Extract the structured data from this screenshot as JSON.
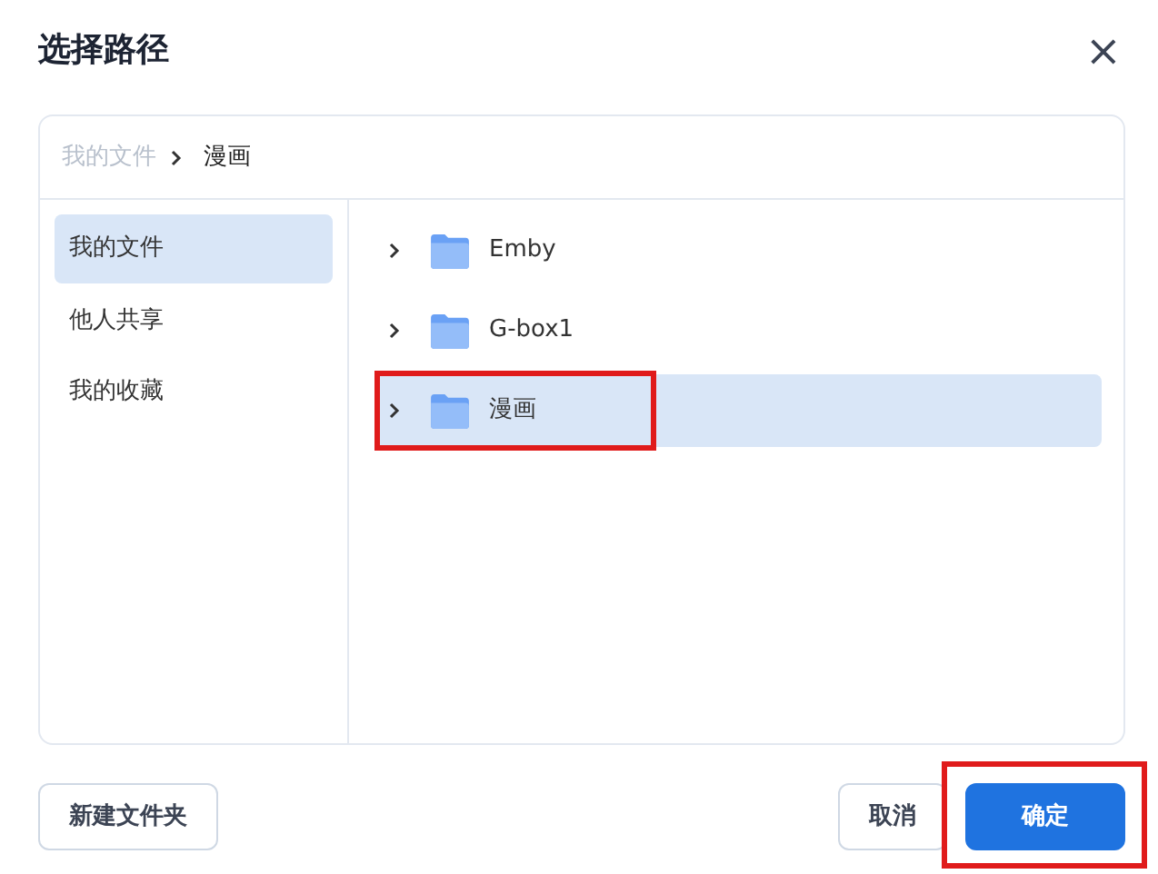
{
  "dialog": {
    "title": "选择路径",
    "close": "×"
  },
  "breadcrumb": [
    {
      "label": "我的文件",
      "current": false
    },
    {
      "label": "漫画",
      "current": true
    }
  ],
  "sidebar": {
    "items": [
      {
        "label": "我的文件",
        "selected": true
      },
      {
        "label": "他人共享",
        "selected": false
      },
      {
        "label": "我的收藏",
        "selected": false
      }
    ]
  },
  "folders": [
    {
      "name": "Emby",
      "selected": false,
      "highlighted": false
    },
    {
      "name": "G-box1",
      "selected": false,
      "highlighted": false
    },
    {
      "name": "漫画",
      "selected": true,
      "highlighted": true
    }
  ],
  "buttons": [
    {
      "label": "新建文件夹",
      "kind": "outline",
      "highlighted": false
    },
    {
      "label": "取消",
      "kind": "outline",
      "highlighted": false
    },
    {
      "label": "确定",
      "kind": "primary",
      "highlighted": true
    }
  ]
}
